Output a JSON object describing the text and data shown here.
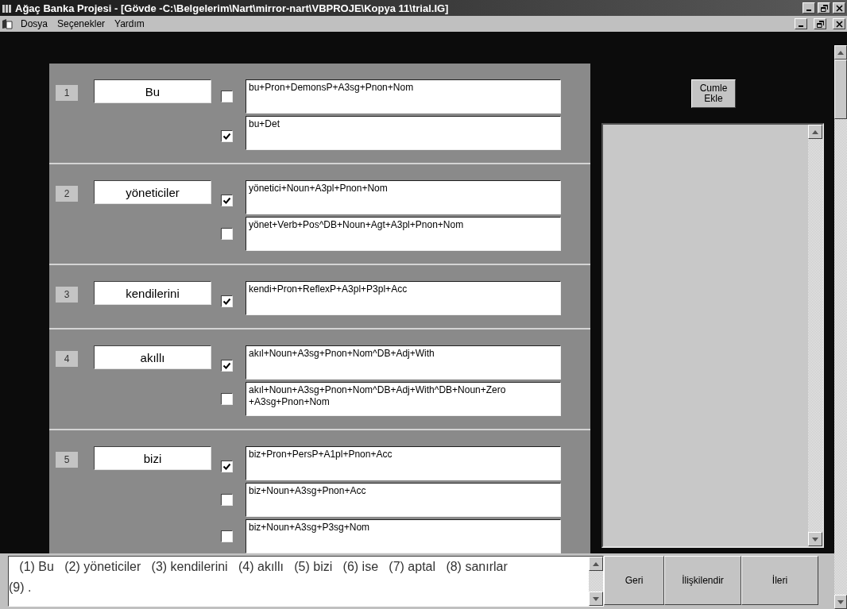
{
  "window": {
    "title": "Ağaç Banka Projesi - [Gövde -C:\\Belgelerim\\Nart\\mirror-nart\\VBPROJE\\Kopya 11\\trial.IG]"
  },
  "menu": [
    "Dosya",
    "Seçenekler",
    "Yardım"
  ],
  "words": [
    {
      "index": "1",
      "word": "Bu",
      "analyses": [
        {
          "text": "bu+Pron+DemonsP+A3sg+Pnon+Nom",
          "checked": false
        },
        {
          "text": "bu+Det",
          "checked": true
        }
      ]
    },
    {
      "index": "2",
      "word": "yöneticiler",
      "analyses": [
        {
          "text": "yönetici+Noun+A3pl+Pnon+Nom",
          "checked": true
        },
        {
          "text": "yönet+Verb+Pos^DB+Noun+Agt+A3pl+Pnon+Nom",
          "checked": false
        }
      ]
    },
    {
      "index": "3",
      "word": "kendilerini",
      "analyses": [
        {
          "text": "kendi+Pron+ReflexP+A3pl+P3pl+Acc",
          "checked": true
        }
      ]
    },
    {
      "index": "4",
      "word": "akıllı",
      "analyses": [
        {
          "text": "akıl+Noun+A3sg+Pnon+Nom^DB+Adj+With",
          "checked": true
        },
        {
          "text": "akıl+Noun+A3sg+Pnon+Nom^DB+Adj+With^DB+Noun+Zero +A3sg+Pnon+Nom",
          "checked": false
        }
      ]
    },
    {
      "index": "5",
      "word": "bizi",
      "analyses": [
        {
          "text": "biz+Pron+PersP+A1pl+Pnon+Acc",
          "checked": true
        },
        {
          "text": "biz+Noun+A3sg+Pnon+Acc",
          "checked": false
        },
        {
          "text": "biz+Noun+A3sg+P3sg+Nom",
          "checked": false
        }
      ]
    }
  ],
  "add_sentence_button": "Cumle Ekle",
  "sentence": "   (1) Bu   (2) yöneticiler   (3) kendilerini   (4) akıllı   (5) bizi   (6) ise   (7) aptal   (8) sanırlar   (9) .",
  "buttons": [
    "Geri",
    "İlişkilendir",
    "İleri"
  ]
}
